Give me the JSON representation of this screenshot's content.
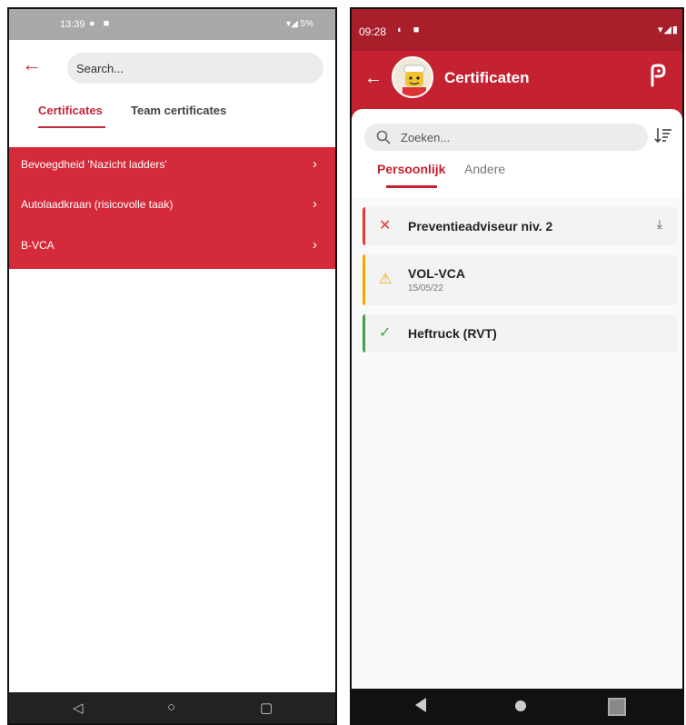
{
  "phone1": {
    "status_bar": {
      "time": "13:39",
      "right": "5%"
    },
    "search": {
      "placeholder": "Search..."
    },
    "tabs": [
      {
        "label": "Certificates",
        "active": true
      },
      {
        "label": "Team certificates",
        "active": false
      }
    ],
    "items": [
      {
        "label": "Bevoegdheid 'Nazicht ladders'"
      },
      {
        "label": "Autolaadkraan (risicovolle taak)"
      },
      {
        "label": "B-VCA"
      }
    ],
    "nav": {
      "back": "◁",
      "home": "○",
      "recent": "▢"
    },
    "colors": {
      "accent": "#d42a3a",
      "status_bar": "#a9a9a9"
    }
  },
  "phone2": {
    "status_bar": {
      "time": "09:28"
    },
    "header": {
      "title": "Certificaten"
    },
    "search": {
      "placeholder": "Zoeken..."
    },
    "tabs": [
      {
        "label": "Persoonlijk",
        "active": true
      },
      {
        "label": "Andere",
        "active": false
      }
    ],
    "certificates": [
      {
        "name": "Preventieadviseur niv. 2",
        "status": "expired",
        "status_icon": "✕",
        "status_color": "#e53935",
        "has_download": true,
        "download_icon": "⤓"
      },
      {
        "name": "VOL-VCA",
        "date": "15/05/22",
        "status": "warning",
        "status_icon": "⚠",
        "status_color": "#f0a500",
        "has_download": false
      },
      {
        "name": "Heftruck (RVT)",
        "status": "valid",
        "status_icon": "✓",
        "status_color": "#43a047",
        "has_download": false
      }
    ],
    "colors": {
      "header": "#c42231",
      "status_bar": "#a91e2b"
    }
  }
}
